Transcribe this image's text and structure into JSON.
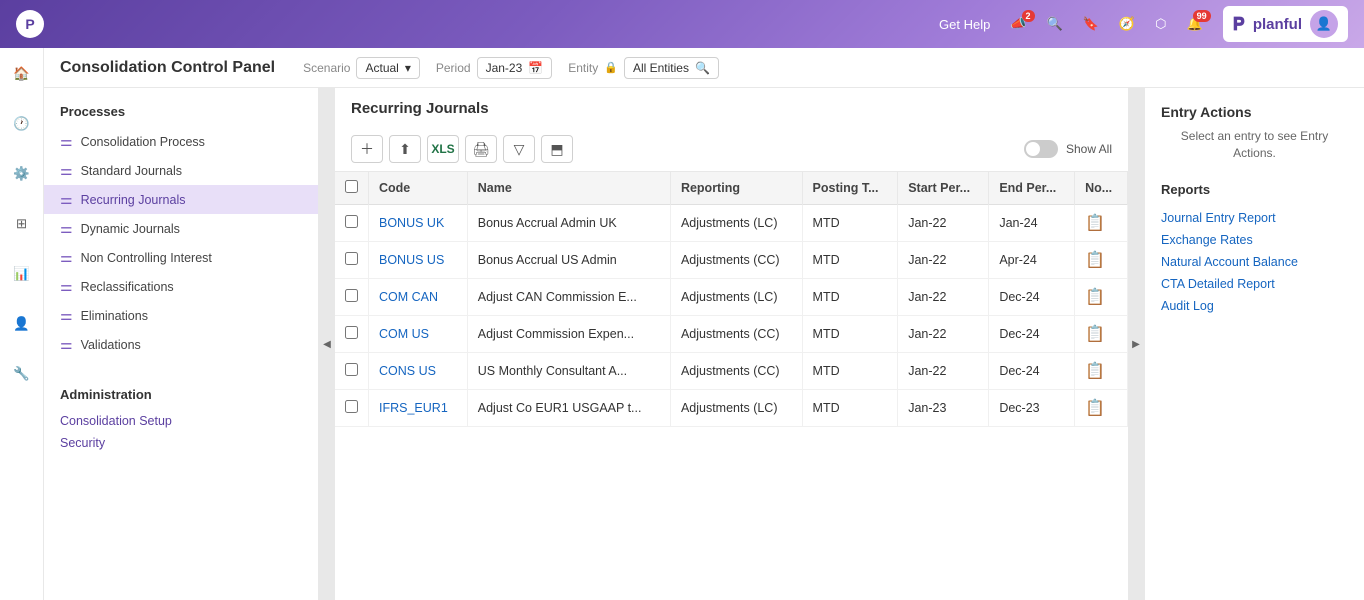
{
  "topNav": {
    "getHelp": "Get Help",
    "notifications_count": "99",
    "brand": "planful",
    "logo_char": "P"
  },
  "header": {
    "title": "Consolidation Control Panel",
    "scenario_label": "Scenario",
    "scenario_value": "Actual",
    "period_label": "Period",
    "period_value": "Jan-23",
    "entity_label": "Entity",
    "entity_value": "All Entities"
  },
  "processes": {
    "section_title": "Processes",
    "items": [
      {
        "id": "consolidation-process",
        "label": "Consolidation Process",
        "active": false
      },
      {
        "id": "standard-journals",
        "label": "Standard Journals",
        "active": false
      },
      {
        "id": "recurring-journals",
        "label": "Recurring Journals",
        "active": true
      },
      {
        "id": "dynamic-journals",
        "label": "Dynamic Journals",
        "active": false
      },
      {
        "id": "non-controlling-interest",
        "label": "Non Controlling Interest",
        "active": false
      },
      {
        "id": "reclassifications",
        "label": "Reclassifications",
        "active": false
      },
      {
        "id": "eliminations",
        "label": "Eliminations",
        "active": false
      },
      {
        "id": "validations",
        "label": "Validations",
        "active": false
      }
    ]
  },
  "administration": {
    "section_title": "Administration",
    "links": [
      {
        "id": "consolidation-setup",
        "label": "Consolidation Setup"
      },
      {
        "id": "security",
        "label": "Security"
      }
    ]
  },
  "panel": {
    "title": "Recurring Journals",
    "show_all_label": "Show All",
    "table": {
      "columns": [
        {
          "id": "code",
          "label": "Code"
        },
        {
          "id": "name",
          "label": "Name"
        },
        {
          "id": "reporting",
          "label": "Reporting"
        },
        {
          "id": "posting_type",
          "label": "Posting T..."
        },
        {
          "id": "start_period",
          "label": "Start Per..."
        },
        {
          "id": "end_period",
          "label": "End Per..."
        },
        {
          "id": "notes",
          "label": "No..."
        }
      ],
      "rows": [
        {
          "code": "BONUS UK",
          "name": "Bonus Accrual Admin UK",
          "reporting": "Adjustments (LC)",
          "posting_type": "MTD",
          "start_period": "Jan-22",
          "end_period": "Jan-24"
        },
        {
          "code": "BONUS US",
          "name": "Bonus Accrual US Admin",
          "reporting": "Adjustments (CC)",
          "posting_type": "MTD",
          "start_period": "Jan-22",
          "end_period": "Apr-24"
        },
        {
          "code": "COM CAN",
          "name": "Adjust CAN Commission E...",
          "reporting": "Adjustments (LC)",
          "posting_type": "MTD",
          "start_period": "Jan-22",
          "end_period": "Dec-24"
        },
        {
          "code": "COM US",
          "name": "Adjust Commission Expen...",
          "reporting": "Adjustments (CC)",
          "posting_type": "MTD",
          "start_period": "Jan-22",
          "end_period": "Dec-24"
        },
        {
          "code": "CONS US",
          "name": "US Monthly Consultant A...",
          "reporting": "Adjustments (CC)",
          "posting_type": "MTD",
          "start_period": "Jan-22",
          "end_period": "Dec-24"
        },
        {
          "code": "IFRS_EUR1",
          "name": "Adjust Co EUR1 USGAAP t...",
          "reporting": "Adjustments (LC)",
          "posting_type": "MTD",
          "start_period": "Jan-23",
          "end_period": "Dec-23"
        }
      ]
    }
  },
  "entryActions": {
    "title": "Entry Actions",
    "subtitle": "Select an entry to see Entry Actions.",
    "reports_title": "Reports",
    "reports": [
      {
        "id": "journal-entry-report",
        "label": "Journal Entry Report"
      },
      {
        "id": "exchange-rates",
        "label": "Exchange Rates"
      },
      {
        "id": "natural-account-balance",
        "label": "Natural Account Balance"
      },
      {
        "id": "cta-detailed-report",
        "label": "CTA Detailed Report"
      },
      {
        "id": "audit-log",
        "label": "Audit Log"
      }
    ]
  }
}
